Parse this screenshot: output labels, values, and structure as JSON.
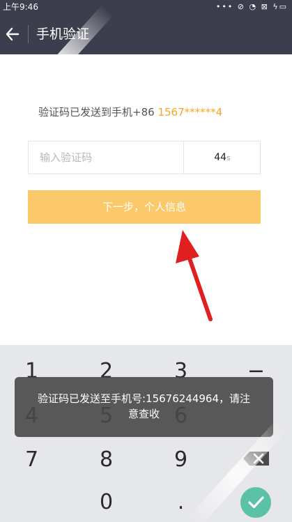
{
  "status_bar": {
    "time": "上午9:46",
    "icons": [
      "more-dots-icon",
      "alarm-off-icon",
      "wifi-icon",
      "sim-icon",
      "charging-icon"
    ]
  },
  "app_bar": {
    "title": "手机验证"
  },
  "verification": {
    "sent_label": "验证码已发送到手机+86 ",
    "phone_masked": "1567******4",
    "phone_color": "#f5a623",
    "code_placeholder": "输入验证码",
    "countdown_value": "44",
    "countdown_unit": "s"
  },
  "next_button": {
    "label": "下一步，个人信息",
    "color": "#fcc96a"
  },
  "keypad": {
    "keys": [
      "1",
      "2",
      "3",
      "−",
      "4",
      "5",
      "6",
      "7",
      "8",
      "9",
      "",
      "0",
      "."
    ],
    "delete_icon": "backspace-icon",
    "confirm_icon": "check-icon",
    "confirm_color": "#5cc2a7"
  },
  "toast": {
    "line1": "验证码已发送至手机号:15676244964，请注",
    "line2": "意查收"
  },
  "annotation": {
    "arrow_color": "#e02020",
    "arrow_icon": "red-arrow-annotation"
  }
}
